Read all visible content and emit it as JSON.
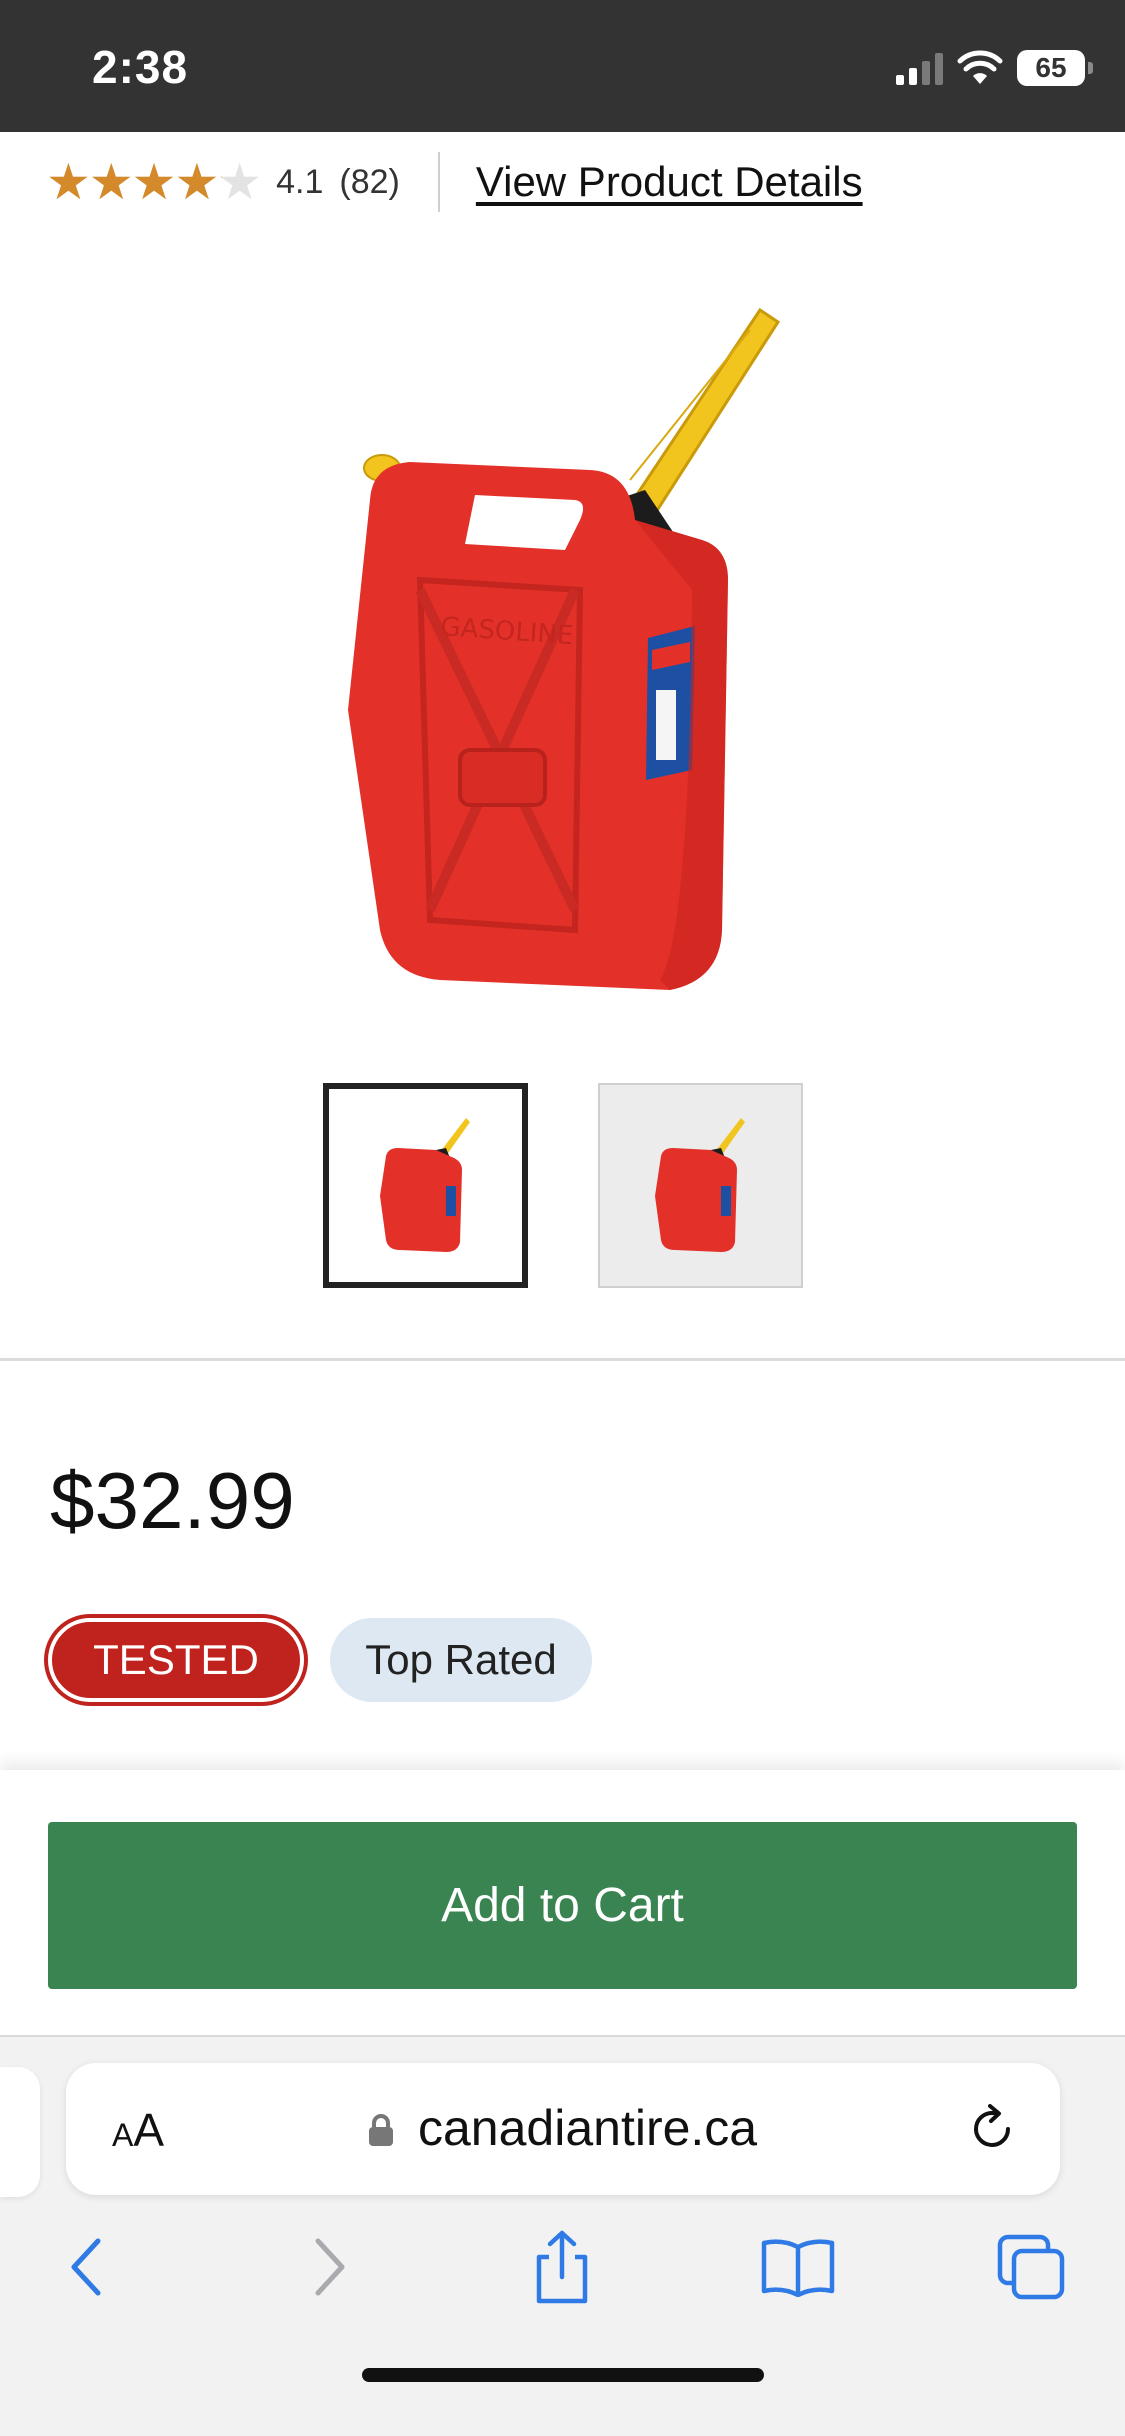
{
  "status": {
    "time": "2:38",
    "battery": "65"
  },
  "rating": {
    "value": "4.1",
    "fill_fraction": 0.82,
    "count": "(82)",
    "stars": "★★★★★"
  },
  "view_details": "View Product Details",
  "product": {
    "price": "$32.99",
    "image_alt": "Red gasoline jerry can with yellow spout"
  },
  "badges": {
    "tested": "TESTED",
    "top_rated": "Top Rated"
  },
  "cart": {
    "button_label": "Add to Cart"
  },
  "browser": {
    "aa_small": "A",
    "aa_large": "A",
    "url": "canadiantire.ca"
  },
  "colors": {
    "accent_green": "#3a8451",
    "badge_red": "#c0231e",
    "star_gold": "#d48a2a",
    "badge_blue": "#dde8f3"
  }
}
